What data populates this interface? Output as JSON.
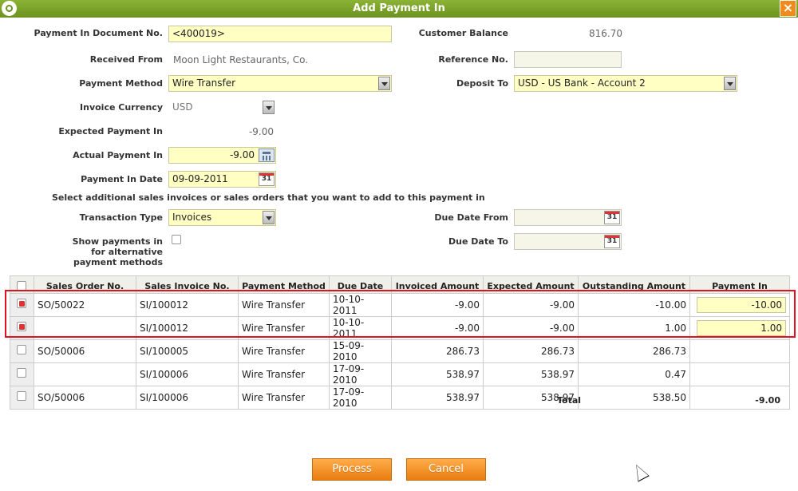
{
  "window": {
    "title": "Add Payment In",
    "close_symbol": "×"
  },
  "form": {
    "doc_no_label": "Payment In Document No.",
    "doc_no_value": "<400019>",
    "customer_balance_label": "Customer Balance",
    "customer_balance_value": "816.70",
    "received_from_label": "Received From",
    "received_from_value": "Moon Light Restaurants, Co.",
    "reference_no_label": "Reference No.",
    "reference_no_value": "",
    "payment_method_label": "Payment Method",
    "payment_method_value": "Wire Transfer",
    "deposit_to_label": "Deposit To",
    "deposit_to_value": "USD - US Bank - Account 2",
    "invoice_currency_label": "Invoice Currency",
    "invoice_currency_value": "USD",
    "expected_payment_label": "Expected Payment In",
    "expected_payment_value": "-9.00",
    "actual_payment_label": "Actual Payment In",
    "actual_payment_value": "-9.00",
    "payment_date_label": "Payment In Date",
    "payment_date_value": "09-09-2011",
    "select_note": "Select additional sales invoices or sales orders that you want to add to this payment in",
    "transaction_type_label": "Transaction Type",
    "transaction_type_value": "Invoices",
    "due_date_from_label": "Due Date From",
    "due_date_to_label": "Due Date To",
    "show_payments_label_1": "Show payments in",
    "show_payments_label_2": "for alternative",
    "show_payments_label_3": "payment methods",
    "calendar_glyph": "31"
  },
  "table": {
    "headers": [
      "Sales Order No.",
      "Sales Invoice No.",
      "Payment Method",
      "Due Date",
      "Invoiced Amount",
      "Expected Amount",
      "Outstanding Amount",
      "Payment In"
    ],
    "rows": [
      {
        "checked": true,
        "so": "SO/50022",
        "si": "SI/100012",
        "method": "Wire Transfer",
        "due": "10-10-2011",
        "invoiced": "-9.00",
        "expected": "-9.00",
        "outstanding": "-10.00",
        "payment": "-10.00"
      },
      {
        "checked": true,
        "so": "",
        "si": "SI/100012",
        "method": "Wire Transfer",
        "due": "10-10-2011",
        "invoiced": "-9.00",
        "expected": "-9.00",
        "outstanding": "1.00",
        "payment": "1.00"
      },
      {
        "checked": false,
        "so": "SO/50006",
        "si": "SI/100005",
        "method": "Wire Transfer",
        "due": "15-09-2010",
        "invoiced": "286.73",
        "expected": "286.73",
        "outstanding": "286.73",
        "payment": ""
      },
      {
        "checked": false,
        "so": "",
        "si": "SI/100006",
        "method": "Wire Transfer",
        "due": "17-09-2010",
        "invoiced": "538.97",
        "expected": "538.97",
        "outstanding": "0.47",
        "payment": ""
      },
      {
        "checked": false,
        "so": "SO/50006",
        "si": "SI/100006",
        "method": "Wire Transfer",
        "due": "17-09-2010",
        "invoiced": "538.97",
        "expected": "538.97",
        "outstanding": "538.50",
        "payment": ""
      }
    ],
    "total_label": "Total",
    "total_value": "-9.00"
  },
  "buttons": {
    "process": "Process",
    "cancel": "Cancel"
  },
  "colors": {
    "title_bar": "#7aa52b",
    "accent_orange": "#f08a1c",
    "input_yellow": "#ffffc4",
    "highlight_red": "#e0141e"
  }
}
